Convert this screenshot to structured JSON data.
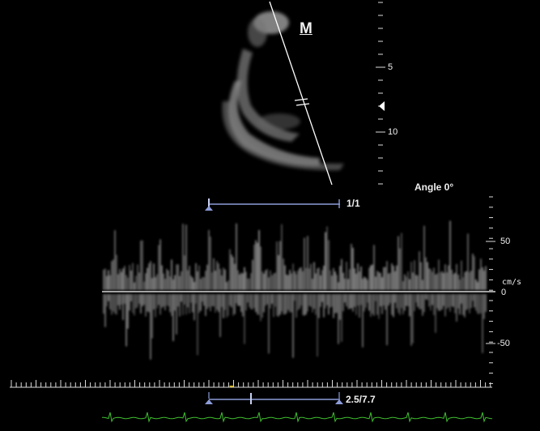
{
  "mode_marker": "M",
  "depth_labels": [
    "5",
    "10"
  ],
  "angle_label": "Angle 0°",
  "frame_counter": "1/1",
  "velocity_unit": "cm/s",
  "velocity_labels": [
    "50",
    "0",
    "-50"
  ],
  "sweep_readout": "2.5/7.7",
  "colors": {
    "background": "#000000",
    "text": "#f0f0f0",
    "cursor_line": "#ffffff",
    "slider": "#8c9cd8",
    "ecg": "#3fbf2f"
  },
  "icons": {
    "depth_marker": "triangle-left-icon",
    "cursor_break": "double-slash-icon",
    "slider_handle": "triangle-up-icon"
  }
}
